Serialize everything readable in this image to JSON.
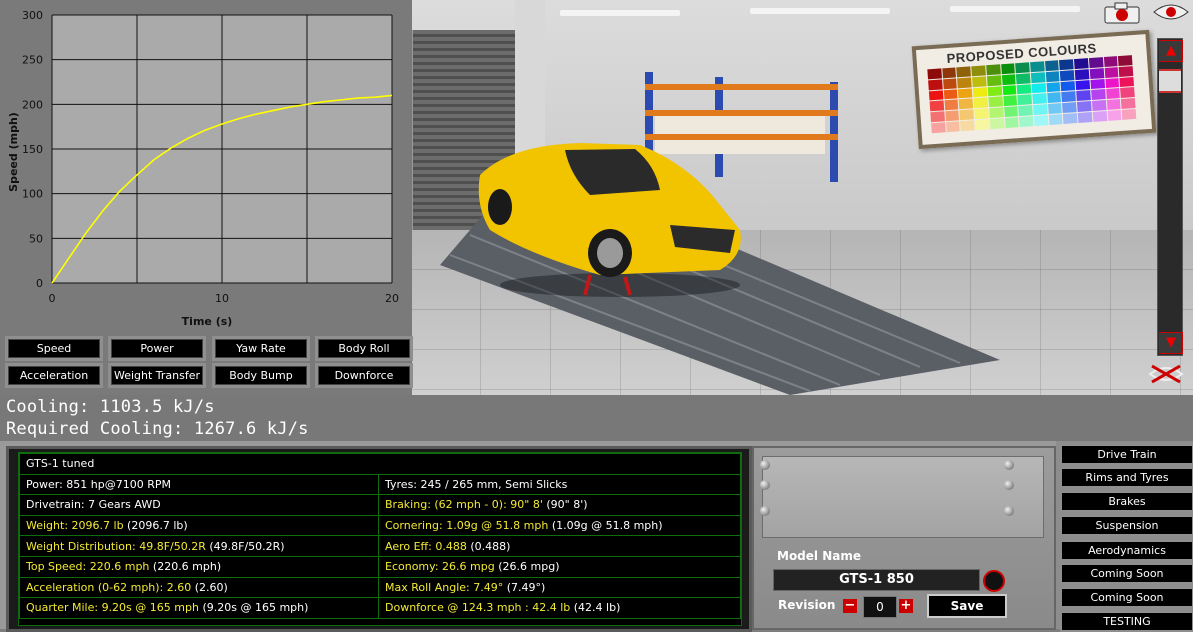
{
  "graph": {
    "y_axis_label": "Speed (mph)",
    "x_axis_label": "Time (s)",
    "y_ticks": [
      "300",
      "250",
      "200",
      "150",
      "100",
      "50",
      "0"
    ],
    "x_ticks": [
      "0",
      "10",
      "20"
    ],
    "line_color": "#ffff00"
  },
  "chart_data": {
    "type": "line",
    "title": "",
    "xlabel": "Time (s)",
    "ylabel": "Speed (mph)",
    "xlim": [
      0,
      20
    ],
    "ylim": [
      0,
      300
    ],
    "grid": true,
    "series": [
      {
        "x": [
          0,
          1,
          2,
          3,
          4,
          5,
          6,
          7,
          8,
          9,
          10,
          11,
          12,
          13,
          14,
          15,
          16,
          17,
          18,
          19,
          20
        ],
        "y": [
          0,
          28,
          56,
          81,
          103,
          121,
          138,
          151,
          162,
          171,
          178,
          184,
          189,
          193,
          197,
          200,
          203,
          205,
          207,
          208,
          210
        ]
      }
    ]
  },
  "graph_buttons": {
    "row1": [
      "Speed",
      "Power",
      "Yaw Rate",
      "Body Roll"
    ],
    "row2": [
      "Acceleration",
      "Weight Transfer",
      "Body Bump",
      "Downforce"
    ]
  },
  "cooling": {
    "cooling": "Cooling: 1103.5 kJ/s",
    "required": "Required Cooling: 1267.6 kJ/s"
  },
  "scene": {
    "poster_title": "PROPOSED COLOURS",
    "car_color": "#f2c400"
  },
  "stats": {
    "header": "GTS-1 tuned",
    "rows": [
      [
        {
          "text": "Power: 851 hp@7100 RPM",
          "hl": false
        },
        {
          "text": "Tyres: 245 / 265 mm, Semi Slicks",
          "hl": false
        }
      ],
      [
        {
          "text": "Drivetrain: 7 Gears AWD",
          "hl": false
        },
        {
          "text": "Braking: (62 mph - 0): 90\" 8'",
          "extra": " (90\" 8')",
          "hl": true
        }
      ],
      [
        {
          "text": "Weight: 2096.7 lb",
          "extra": " (2096.7 lb)",
          "hl": true
        },
        {
          "text": "Cornering: 1.09g @ 51.8 mph",
          "extra": " (1.09g @ 51.8 mph)",
          "hl": true
        }
      ],
      [
        {
          "text": "Weight Distribution: 49.8F/50.2R",
          "extra": " (49.8F/50.2R)",
          "hl": true
        },
        {
          "text": "Aero Eff: 0.488",
          "extra": " (0.488)",
          "hl": true
        }
      ],
      [
        {
          "text": "Top Speed: 220.6 mph",
          "extra": " (220.6 mph)",
          "hl": true
        },
        {
          "text": "Economy: 26.6 mpg",
          "extra": " (26.6 mpg)",
          "hl": true
        }
      ],
      [
        {
          "text": "Acceleration (0-62 mph): 2.60",
          "extra": " (2.60)",
          "hl": true
        },
        {
          "text": "Max Roll Angle: 7.49°",
          "extra": " (7.49°)",
          "hl": true
        }
      ],
      [
        {
          "text": "Quarter Mile: 9.20s @ 165 mph",
          "extra": " (9.20s @ 165 mph)",
          "hl": true
        },
        {
          "text": "Downforce @ 124.3 mph : 42.4 lb",
          "extra": " (42.4 lb)",
          "hl": true
        }
      ]
    ]
  },
  "model": {
    "label": "Model Name",
    "name": "GTS-1 850",
    "revision_label": "Revision",
    "revision_value": "0",
    "minus": "−",
    "plus": "+",
    "save_label": "Save"
  },
  "side_menu": [
    "Drive Train",
    "Rims and Tyres",
    "Brakes",
    "Suspension",
    "Aerodynamics",
    "Coming Soon",
    "Coming Soon",
    "TESTING"
  ],
  "icons": {
    "camera": "camera-icon",
    "eye": "eye-icon",
    "scroll_up": "▲",
    "scroll_down": "▼",
    "reset_view": "reset-view-icon"
  }
}
